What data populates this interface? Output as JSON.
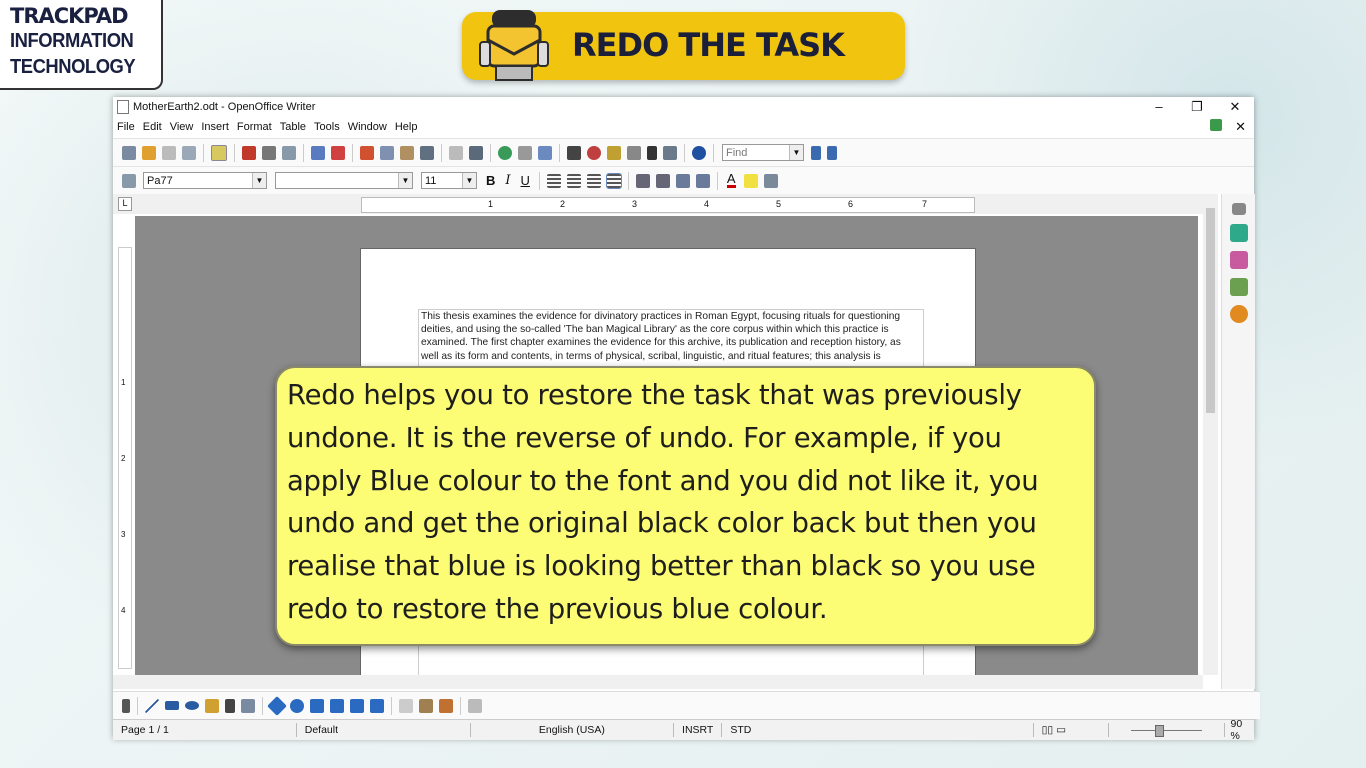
{
  "brand": {
    "line1": "TRACKPAD",
    "line2": "INFORMATION",
    "line3": "TECHNOLOGY"
  },
  "banner": {
    "title": "REDO THE TASK",
    "color": "#f1c40f"
  },
  "window": {
    "title": "MotherEarth2.odt - OpenOffice Writer",
    "controls": {
      "minimize": "–",
      "restore": "❐",
      "close": "✕"
    }
  },
  "menu": [
    "File",
    "Edit",
    "View",
    "Insert",
    "Format",
    "Table",
    "Tools",
    "Window",
    "Help"
  ],
  "menu_close": "✕",
  "toolbar": {
    "find_placeholder": "Find"
  },
  "format": {
    "style": "Pa77",
    "font": "",
    "size": "11",
    "bold": "B",
    "italic": "I",
    "underline": "U",
    "font_color_glyph": "A"
  },
  "ruler": {
    "tab_selector": "L",
    "numbers": [
      "1",
      "2",
      "3",
      "4",
      "5",
      "6",
      "7"
    ]
  },
  "vruler": {
    "numbers": [
      "1",
      "2",
      "3",
      "4"
    ]
  },
  "document": {
    "text": "This thesis examines the evidence for divinatory practices in Roman Egypt, focusing rituals for questioning deities, and using the so-called 'The ban Magical Library' as the core corpus within which this practice is examined. The first chapter examines the evidence for this archive, its publication and reception history, as well as its form and contents, in terms of physical, scribal, linguistic, and ritual features; this analysis is"
  },
  "callout": {
    "text": "Redo helps you to restore the task that was previously undone. It is the reverse of undo. For example, if you apply Blue colour to the font and you did not like it, you undo and get the original black color back but then you realise that blue is looking better than black so you use redo to restore the previous blue colour.",
    "background": "#fdfd75"
  },
  "statusbar": {
    "page": "Page 1 / 1",
    "style": "Default",
    "language": "English (USA)",
    "insert": "INSRT",
    "selection": "STD",
    "zoom": "90 %"
  }
}
